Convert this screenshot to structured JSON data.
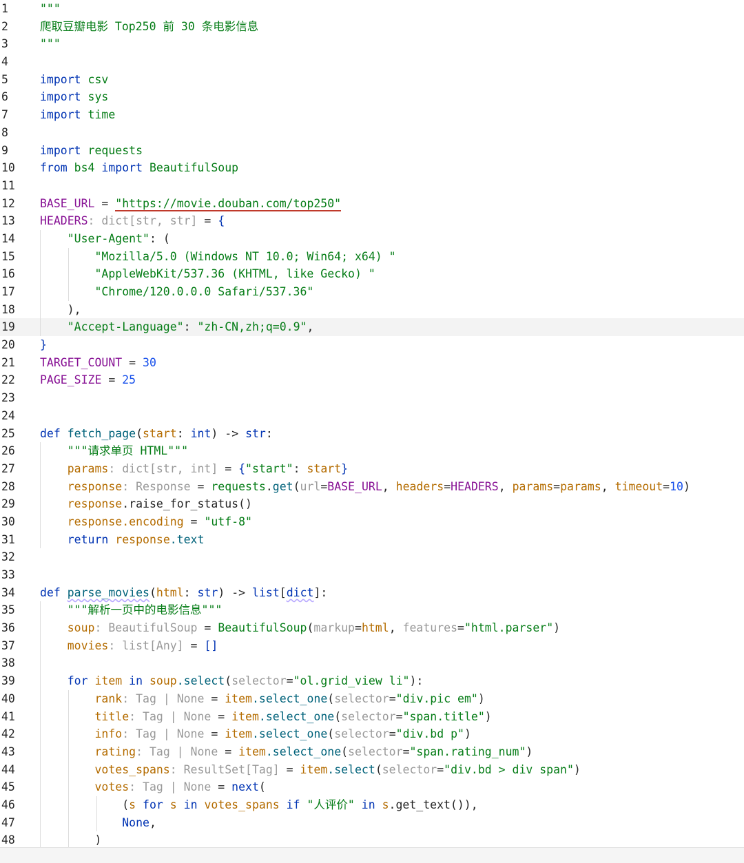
{
  "editor": {
    "current_line": 19,
    "lines": [
      {
        "n": "1",
        "indent": 0,
        "tokens": [
          [
            "\"\"\"",
            "doc"
          ]
        ]
      },
      {
        "n": "2",
        "indent": 0,
        "tokens": [
          [
            "爬取豆瓣电影 Top250 前 30 条电影信息",
            "doc"
          ]
        ]
      },
      {
        "n": "3",
        "indent": 0,
        "tokens": [
          [
            "\"\"\"",
            "doc"
          ]
        ]
      },
      {
        "n": "4",
        "indent": 0,
        "tokens": []
      },
      {
        "n": "5",
        "indent": 0,
        "tokens": [
          [
            "import",
            "kw"
          ],
          [
            " csv",
            "mod"
          ]
        ]
      },
      {
        "n": "6",
        "indent": 0,
        "tokens": [
          [
            "import",
            "kw"
          ],
          [
            " sys",
            "mod"
          ]
        ]
      },
      {
        "n": "7",
        "indent": 0,
        "tokens": [
          [
            "import",
            "kw"
          ],
          [
            " time",
            "mod"
          ]
        ]
      },
      {
        "n": "8",
        "indent": 0,
        "tokens": []
      },
      {
        "n": "9",
        "indent": 0,
        "tokens": [
          [
            "import",
            "kw"
          ],
          [
            " requests",
            "mod"
          ]
        ]
      },
      {
        "n": "10",
        "indent": 0,
        "tokens": [
          [
            "from",
            "kw"
          ],
          [
            " bs4 ",
            "mod"
          ],
          [
            "import",
            "kw"
          ],
          [
            " BeautifulSoup",
            "mod"
          ]
        ]
      },
      {
        "n": "11",
        "indent": 0,
        "tokens": []
      },
      {
        "n": "12",
        "indent": 0,
        "tokens": [
          [
            "BASE_URL",
            "const"
          ],
          [
            " = ",
            "punct"
          ],
          [
            "\"https://movie.douban.com/top250\"",
            "str",
            "ul-red"
          ]
        ]
      },
      {
        "n": "13",
        "indent": 0,
        "tokens": [
          [
            "HEADERS",
            "const"
          ],
          [
            ": dict[str, str]",
            "type"
          ],
          [
            " = ",
            "punct"
          ],
          [
            "{",
            "pblue"
          ]
        ]
      },
      {
        "n": "14",
        "indent": 1,
        "tokens": [
          [
            "    \"User-Agent\"",
            "str"
          ],
          [
            ": (",
            "punct"
          ]
        ]
      },
      {
        "n": "15",
        "indent": 2,
        "tokens": [
          [
            "        \"Mozilla/5.0 (Windows NT 10.0; Win64; x64) \"",
            "str"
          ]
        ]
      },
      {
        "n": "16",
        "indent": 2,
        "tokens": [
          [
            "        \"AppleWebKit/537.36 (KHTML, like Gecko) \"",
            "str"
          ]
        ]
      },
      {
        "n": "17",
        "indent": 2,
        "tokens": [
          [
            "        \"Chrome/120.0.0.0 Safari/537.36\"",
            "str"
          ]
        ]
      },
      {
        "n": "18",
        "indent": 1,
        "tokens": [
          [
            "    ),",
            "punct"
          ]
        ]
      },
      {
        "n": "19",
        "indent": 1,
        "tokens": [
          [
            "    \"Accept-Language\"",
            "str"
          ],
          [
            ": ",
            "punct"
          ],
          [
            "\"zh-CN,zh;q=0.9\"",
            "str"
          ],
          [
            ",",
            "punct"
          ]
        ]
      },
      {
        "n": "20",
        "indent": 0,
        "tokens": [
          [
            "}",
            "pblue"
          ]
        ]
      },
      {
        "n": "21",
        "indent": 0,
        "tokens": [
          [
            "TARGET_COUNT",
            "const"
          ],
          [
            " = ",
            "punct"
          ],
          [
            "30",
            "num"
          ]
        ]
      },
      {
        "n": "22",
        "indent": 0,
        "tokens": [
          [
            "PAGE_SIZE",
            "const"
          ],
          [
            " = ",
            "punct"
          ],
          [
            "25",
            "num"
          ]
        ]
      },
      {
        "n": "23",
        "indent": 0,
        "tokens": []
      },
      {
        "n": "24",
        "indent": 0,
        "tokens": []
      },
      {
        "n": "25",
        "indent": 0,
        "tokens": [
          [
            "def",
            "kw"
          ],
          [
            " ",
            "punct"
          ],
          [
            "fetch_page",
            "func"
          ],
          [
            "(",
            "punct"
          ],
          [
            "start",
            "param"
          ],
          [
            ": ",
            "punct"
          ],
          [
            "int",
            "builtin"
          ],
          [
            ") -> ",
            "punct"
          ],
          [
            "str",
            "builtin"
          ],
          [
            ":",
            "punct"
          ]
        ]
      },
      {
        "n": "26",
        "indent": 1,
        "tokens": [
          [
            "    \"\"\"请求单页 HTML\"\"\"",
            "doc"
          ]
        ]
      },
      {
        "n": "27",
        "indent": 1,
        "tokens": [
          [
            "    params",
            "local"
          ],
          [
            ": dict[str, int]",
            "type"
          ],
          [
            " = ",
            "punct"
          ],
          [
            "{",
            "pblue"
          ],
          [
            "\"start\"",
            "str"
          ],
          [
            ": ",
            "punct"
          ],
          [
            "start",
            "param"
          ],
          [
            "}",
            "pblue"
          ]
        ]
      },
      {
        "n": "28",
        "indent": 1,
        "tokens": [
          [
            "    response",
            "local"
          ],
          [
            ": Response",
            "type"
          ],
          [
            " = ",
            "punct"
          ],
          [
            "requests",
            "mod"
          ],
          [
            ".",
            "punct"
          ],
          [
            "get",
            "attr"
          ],
          [
            "(",
            "punct"
          ],
          [
            "url",
            "type"
          ],
          [
            "=",
            "punct"
          ],
          [
            "BASE_URL",
            "const"
          ],
          [
            ", ",
            "punct"
          ],
          [
            "headers",
            "kwarg"
          ],
          [
            "=",
            "punct"
          ],
          [
            "HEADERS",
            "const"
          ],
          [
            ", ",
            "punct"
          ],
          [
            "params",
            "kwarg"
          ],
          [
            "=",
            "punct"
          ],
          [
            "params",
            "local"
          ],
          [
            ", ",
            "punct"
          ],
          [
            "timeout",
            "kwarg"
          ],
          [
            "=",
            "punct"
          ],
          [
            "10",
            "num"
          ],
          [
            ")",
            "punct"
          ]
        ]
      },
      {
        "n": "29",
        "indent": 1,
        "tokens": [
          [
            "    response",
            "local"
          ],
          [
            ".raise_for_status()",
            "punct"
          ]
        ]
      },
      {
        "n": "30",
        "indent": 1,
        "tokens": [
          [
            "    response",
            "local"
          ],
          [
            ".encoding",
            "local"
          ],
          [
            " = ",
            "punct"
          ],
          [
            "\"utf-8\"",
            "str"
          ]
        ]
      },
      {
        "n": "31",
        "indent": 1,
        "tokens": [
          [
            "    return",
            "kw"
          ],
          [
            " response",
            "local"
          ],
          [
            ".text",
            "attr"
          ]
        ]
      },
      {
        "n": "32",
        "indent": 0,
        "tokens": []
      },
      {
        "n": "33",
        "indent": 0,
        "tokens": []
      },
      {
        "n": "34",
        "indent": 0,
        "tokens": [
          [
            "def",
            "kw"
          ],
          [
            " ",
            "punct"
          ],
          [
            "parse_movies",
            "func",
            "ul-wavy"
          ],
          [
            "(",
            "punct"
          ],
          [
            "html",
            "param"
          ],
          [
            ": ",
            "punct"
          ],
          [
            "str",
            "builtin"
          ],
          [
            ") -> ",
            "punct"
          ],
          [
            "list",
            "builtin"
          ],
          [
            "[",
            "punct"
          ],
          [
            "dict",
            "builtin",
            "ul-wavy"
          ],
          [
            "]:",
            "punct"
          ]
        ]
      },
      {
        "n": "35",
        "indent": 1,
        "tokens": [
          [
            "    \"\"\"解析一页中的电影信息\"\"\"",
            "doc"
          ]
        ]
      },
      {
        "n": "36",
        "indent": 1,
        "tokens": [
          [
            "    soup",
            "local"
          ],
          [
            ": BeautifulSoup",
            "type"
          ],
          [
            " = ",
            "punct"
          ],
          [
            "BeautifulSoup",
            "mod"
          ],
          [
            "(",
            "punct"
          ],
          [
            "markup",
            "type"
          ],
          [
            "=",
            "punct"
          ],
          [
            "html",
            "param"
          ],
          [
            ", ",
            "punct"
          ],
          [
            "features",
            "type"
          ],
          [
            "=",
            "punct"
          ],
          [
            "\"html.parser\"",
            "str"
          ],
          [
            ")",
            "punct"
          ]
        ]
      },
      {
        "n": "37",
        "indent": 1,
        "tokens": [
          [
            "    movies",
            "local"
          ],
          [
            ": list[Any]",
            "type"
          ],
          [
            " = ",
            "punct"
          ],
          [
            "[]",
            "pblue"
          ]
        ]
      },
      {
        "n": "38",
        "indent": 1,
        "tokens": []
      },
      {
        "n": "39",
        "indent": 1,
        "tokens": [
          [
            "    for",
            "kw"
          ],
          [
            " item ",
            "local"
          ],
          [
            "in",
            "kw"
          ],
          [
            " soup",
            "local"
          ],
          [
            ".select",
            "attr"
          ],
          [
            "(",
            "punct"
          ],
          [
            "selector",
            "type"
          ],
          [
            "=",
            "punct"
          ],
          [
            "\"ol.grid_view li\"",
            "str"
          ],
          [
            "):",
            "punct"
          ]
        ]
      },
      {
        "n": "40",
        "indent": 2,
        "tokens": [
          [
            "        rank",
            "local"
          ],
          [
            ": Tag | None",
            "type"
          ],
          [
            " = ",
            "punct"
          ],
          [
            "item",
            "local"
          ],
          [
            ".select_one",
            "attr"
          ],
          [
            "(",
            "punct"
          ],
          [
            "selector",
            "type"
          ],
          [
            "=",
            "punct"
          ],
          [
            "\"div.pic em\"",
            "str"
          ],
          [
            ")",
            "punct"
          ]
        ]
      },
      {
        "n": "41",
        "indent": 2,
        "tokens": [
          [
            "        title",
            "local"
          ],
          [
            ": Tag | None",
            "type"
          ],
          [
            " = ",
            "punct"
          ],
          [
            "item",
            "local"
          ],
          [
            ".select_one",
            "attr"
          ],
          [
            "(",
            "punct"
          ],
          [
            "selector",
            "type"
          ],
          [
            "=",
            "punct"
          ],
          [
            "\"span.title\"",
            "str"
          ],
          [
            ")",
            "punct"
          ]
        ]
      },
      {
        "n": "42",
        "indent": 2,
        "tokens": [
          [
            "        info",
            "local"
          ],
          [
            ": Tag | None",
            "type"
          ],
          [
            " = ",
            "punct"
          ],
          [
            "item",
            "local"
          ],
          [
            ".select_one",
            "attr"
          ],
          [
            "(",
            "punct"
          ],
          [
            "selector",
            "type"
          ],
          [
            "=",
            "punct"
          ],
          [
            "\"div.bd p\"",
            "str"
          ],
          [
            ")",
            "punct"
          ]
        ]
      },
      {
        "n": "43",
        "indent": 2,
        "tokens": [
          [
            "        rating",
            "local"
          ],
          [
            ": Tag | None",
            "type"
          ],
          [
            " = ",
            "punct"
          ],
          [
            "item",
            "local"
          ],
          [
            ".select_one",
            "attr"
          ],
          [
            "(",
            "punct"
          ],
          [
            "selector",
            "type"
          ],
          [
            "=",
            "punct"
          ],
          [
            "\"span.rating_num\"",
            "str"
          ],
          [
            ")",
            "punct"
          ]
        ]
      },
      {
        "n": "44",
        "indent": 2,
        "tokens": [
          [
            "        votes_spans",
            "local"
          ],
          [
            ": ResultSet[Tag]",
            "type"
          ],
          [
            " = ",
            "punct"
          ],
          [
            "item",
            "local"
          ],
          [
            ".select",
            "attr"
          ],
          [
            "(",
            "punct"
          ],
          [
            "selector",
            "type"
          ],
          [
            "=",
            "punct"
          ],
          [
            "\"div.bd > div span\"",
            "str"
          ],
          [
            ")",
            "punct"
          ]
        ]
      },
      {
        "n": "45",
        "indent": 2,
        "tokens": [
          [
            "        votes",
            "local"
          ],
          [
            ": Tag | None",
            "type"
          ],
          [
            " = ",
            "punct"
          ],
          [
            "next",
            "builtin"
          ],
          [
            "(",
            "punct"
          ]
        ]
      },
      {
        "n": "46",
        "indent": 3,
        "tokens": [
          [
            "            (",
            "punct"
          ],
          [
            "s ",
            "local"
          ],
          [
            "for",
            "kw"
          ],
          [
            " s ",
            "local"
          ],
          [
            "in",
            "kw"
          ],
          [
            " votes_spans ",
            "local"
          ],
          [
            "if",
            "kw"
          ],
          [
            " ",
            "punct"
          ],
          [
            "\"人评价\"",
            "str"
          ],
          [
            " in ",
            "kw"
          ],
          [
            "s",
            "local"
          ],
          [
            ".get_text()),",
            "punct"
          ]
        ]
      },
      {
        "n": "47",
        "indent": 3,
        "tokens": [
          [
            "            None",
            "kw"
          ],
          [
            ",",
            "punct"
          ]
        ]
      },
      {
        "n": "48",
        "indent": 2,
        "tokens": [
          [
            "        )",
            "punct"
          ]
        ]
      }
    ]
  }
}
